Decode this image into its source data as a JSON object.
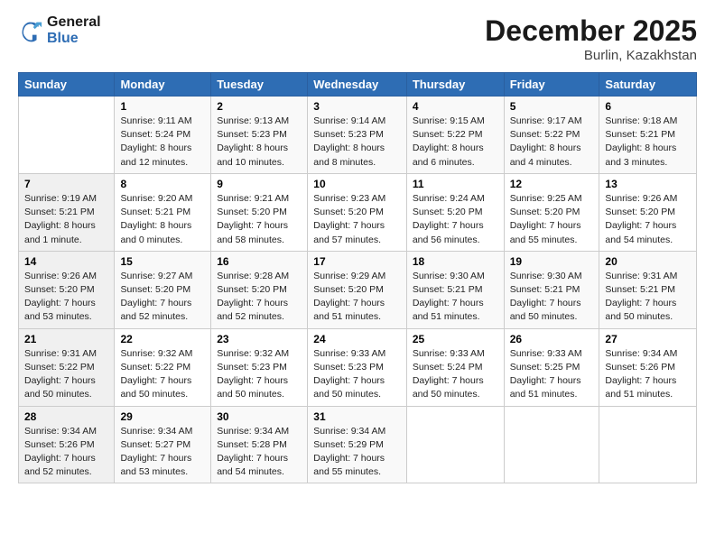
{
  "header": {
    "logo_line1": "General",
    "logo_line2": "Blue",
    "month": "December 2025",
    "location": "Burlin, Kazakhstan"
  },
  "weekdays": [
    "Sunday",
    "Monday",
    "Tuesday",
    "Wednesday",
    "Thursday",
    "Friday",
    "Saturday"
  ],
  "weeks": [
    [
      {
        "day": "",
        "info": ""
      },
      {
        "day": "1",
        "info": "Sunrise: 9:11 AM\nSunset: 5:24 PM\nDaylight: 8 hours\nand 12 minutes."
      },
      {
        "day": "2",
        "info": "Sunrise: 9:13 AM\nSunset: 5:23 PM\nDaylight: 8 hours\nand 10 minutes."
      },
      {
        "day": "3",
        "info": "Sunrise: 9:14 AM\nSunset: 5:23 PM\nDaylight: 8 hours\nand 8 minutes."
      },
      {
        "day": "4",
        "info": "Sunrise: 9:15 AM\nSunset: 5:22 PM\nDaylight: 8 hours\nand 6 minutes."
      },
      {
        "day": "5",
        "info": "Sunrise: 9:17 AM\nSunset: 5:22 PM\nDaylight: 8 hours\nand 4 minutes."
      },
      {
        "day": "6",
        "info": "Sunrise: 9:18 AM\nSunset: 5:21 PM\nDaylight: 8 hours\nand 3 minutes."
      }
    ],
    [
      {
        "day": "7",
        "info": "Sunrise: 9:19 AM\nSunset: 5:21 PM\nDaylight: 8 hours\nand 1 minute."
      },
      {
        "day": "8",
        "info": "Sunrise: 9:20 AM\nSunset: 5:21 PM\nDaylight: 8 hours\nand 0 minutes."
      },
      {
        "day": "9",
        "info": "Sunrise: 9:21 AM\nSunset: 5:20 PM\nDaylight: 7 hours\nand 58 minutes."
      },
      {
        "day": "10",
        "info": "Sunrise: 9:23 AM\nSunset: 5:20 PM\nDaylight: 7 hours\nand 57 minutes."
      },
      {
        "day": "11",
        "info": "Sunrise: 9:24 AM\nSunset: 5:20 PM\nDaylight: 7 hours\nand 56 minutes."
      },
      {
        "day": "12",
        "info": "Sunrise: 9:25 AM\nSunset: 5:20 PM\nDaylight: 7 hours\nand 55 minutes."
      },
      {
        "day": "13",
        "info": "Sunrise: 9:26 AM\nSunset: 5:20 PM\nDaylight: 7 hours\nand 54 minutes."
      }
    ],
    [
      {
        "day": "14",
        "info": "Sunrise: 9:26 AM\nSunset: 5:20 PM\nDaylight: 7 hours\nand 53 minutes."
      },
      {
        "day": "15",
        "info": "Sunrise: 9:27 AM\nSunset: 5:20 PM\nDaylight: 7 hours\nand 52 minutes."
      },
      {
        "day": "16",
        "info": "Sunrise: 9:28 AM\nSunset: 5:20 PM\nDaylight: 7 hours\nand 52 minutes."
      },
      {
        "day": "17",
        "info": "Sunrise: 9:29 AM\nSunset: 5:20 PM\nDaylight: 7 hours\nand 51 minutes."
      },
      {
        "day": "18",
        "info": "Sunrise: 9:30 AM\nSunset: 5:21 PM\nDaylight: 7 hours\nand 51 minutes."
      },
      {
        "day": "19",
        "info": "Sunrise: 9:30 AM\nSunset: 5:21 PM\nDaylight: 7 hours\nand 50 minutes."
      },
      {
        "day": "20",
        "info": "Sunrise: 9:31 AM\nSunset: 5:21 PM\nDaylight: 7 hours\nand 50 minutes."
      }
    ],
    [
      {
        "day": "21",
        "info": "Sunrise: 9:31 AM\nSunset: 5:22 PM\nDaylight: 7 hours\nand 50 minutes."
      },
      {
        "day": "22",
        "info": "Sunrise: 9:32 AM\nSunset: 5:22 PM\nDaylight: 7 hours\nand 50 minutes."
      },
      {
        "day": "23",
        "info": "Sunrise: 9:32 AM\nSunset: 5:23 PM\nDaylight: 7 hours\nand 50 minutes."
      },
      {
        "day": "24",
        "info": "Sunrise: 9:33 AM\nSunset: 5:23 PM\nDaylight: 7 hours\nand 50 minutes."
      },
      {
        "day": "25",
        "info": "Sunrise: 9:33 AM\nSunset: 5:24 PM\nDaylight: 7 hours\nand 50 minutes."
      },
      {
        "day": "26",
        "info": "Sunrise: 9:33 AM\nSunset: 5:25 PM\nDaylight: 7 hours\nand 51 minutes."
      },
      {
        "day": "27",
        "info": "Sunrise: 9:34 AM\nSunset: 5:26 PM\nDaylight: 7 hours\nand 51 minutes."
      }
    ],
    [
      {
        "day": "28",
        "info": "Sunrise: 9:34 AM\nSunset: 5:26 PM\nDaylight: 7 hours\nand 52 minutes."
      },
      {
        "day": "29",
        "info": "Sunrise: 9:34 AM\nSunset: 5:27 PM\nDaylight: 7 hours\nand 53 minutes."
      },
      {
        "day": "30",
        "info": "Sunrise: 9:34 AM\nSunset: 5:28 PM\nDaylight: 7 hours\nand 54 minutes."
      },
      {
        "day": "31",
        "info": "Sunrise: 9:34 AM\nSunset: 5:29 PM\nDaylight: 7 hours\nand 55 minutes."
      },
      {
        "day": "",
        "info": ""
      },
      {
        "day": "",
        "info": ""
      },
      {
        "day": "",
        "info": ""
      }
    ]
  ]
}
